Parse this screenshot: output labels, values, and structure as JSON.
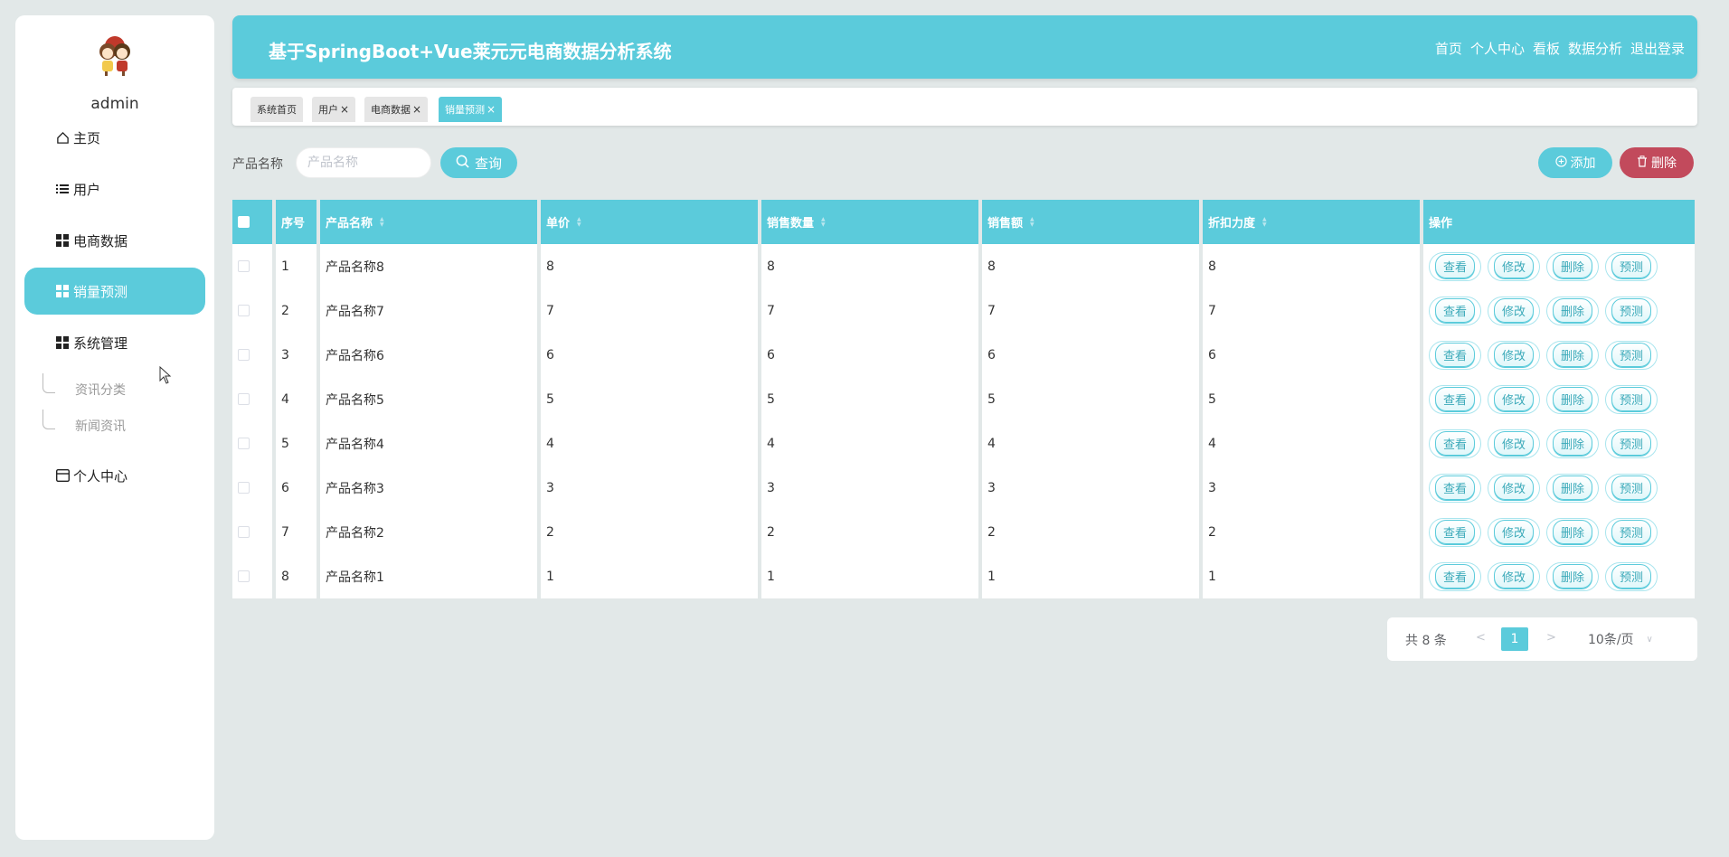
{
  "user": {
    "name": "admin"
  },
  "sidebar": {
    "items": [
      {
        "label": "主页",
        "icon": "home-icon"
      },
      {
        "label": "用户",
        "icon": "list-icon"
      },
      {
        "label": "电商数据",
        "icon": "grid-icon"
      },
      {
        "label": "销量预测",
        "icon": "grid-icon",
        "active": true
      },
      {
        "label": "系统管理",
        "icon": "grid-icon"
      },
      {
        "label": "个人中心",
        "icon": "card-icon"
      }
    ],
    "sub_items": [
      "资讯分类",
      "新闻资讯"
    ]
  },
  "header": {
    "title": "基于SpringBoot+Vue莱元元电商数据分析系统",
    "nav": [
      "首页",
      "个人中心",
      "看板",
      "数据分析",
      "退出登录"
    ]
  },
  "tabs": [
    {
      "label": "系统首页",
      "closable": false
    },
    {
      "label": "用户",
      "closable": true
    },
    {
      "label": "电商数据",
      "closable": true
    },
    {
      "label": "销量预测",
      "closable": true,
      "active": true
    }
  ],
  "search": {
    "label": "产品名称",
    "placeholder": "产品名称",
    "query_button": "查询",
    "add_button": "添加",
    "delete_button": "删除"
  },
  "table": {
    "columns": [
      "序号",
      "产品名称",
      "单价",
      "销售数量",
      "销售额",
      "折扣力度",
      "操作"
    ],
    "rows": [
      [
        "1",
        "产品名称8",
        "8",
        "8",
        "8",
        "8"
      ],
      [
        "2",
        "产品名称7",
        "7",
        "7",
        "7",
        "7"
      ],
      [
        "3",
        "产品名称6",
        "6",
        "6",
        "6",
        "6"
      ],
      [
        "4",
        "产品名称5",
        "5",
        "5",
        "5",
        "5"
      ],
      [
        "5",
        "产品名称4",
        "4",
        "4",
        "4",
        "4"
      ],
      [
        "6",
        "产品名称3",
        "3",
        "3",
        "3",
        "3"
      ],
      [
        "7",
        "产品名称2",
        "2",
        "2",
        "2",
        "2"
      ],
      [
        "8",
        "产品名称1",
        "1",
        "1",
        "1",
        "1"
      ]
    ],
    "actions": [
      "查看",
      "修改",
      "删除",
      "预测"
    ]
  },
  "pagination": {
    "total": "共 8 条",
    "current_page": "1",
    "page_size": "10条/页",
    "prev": "<",
    "next": ">"
  },
  "colors": {
    "accent": "#5bcbdb",
    "danger": "#c24a5c",
    "background": "#e2e8e8"
  }
}
